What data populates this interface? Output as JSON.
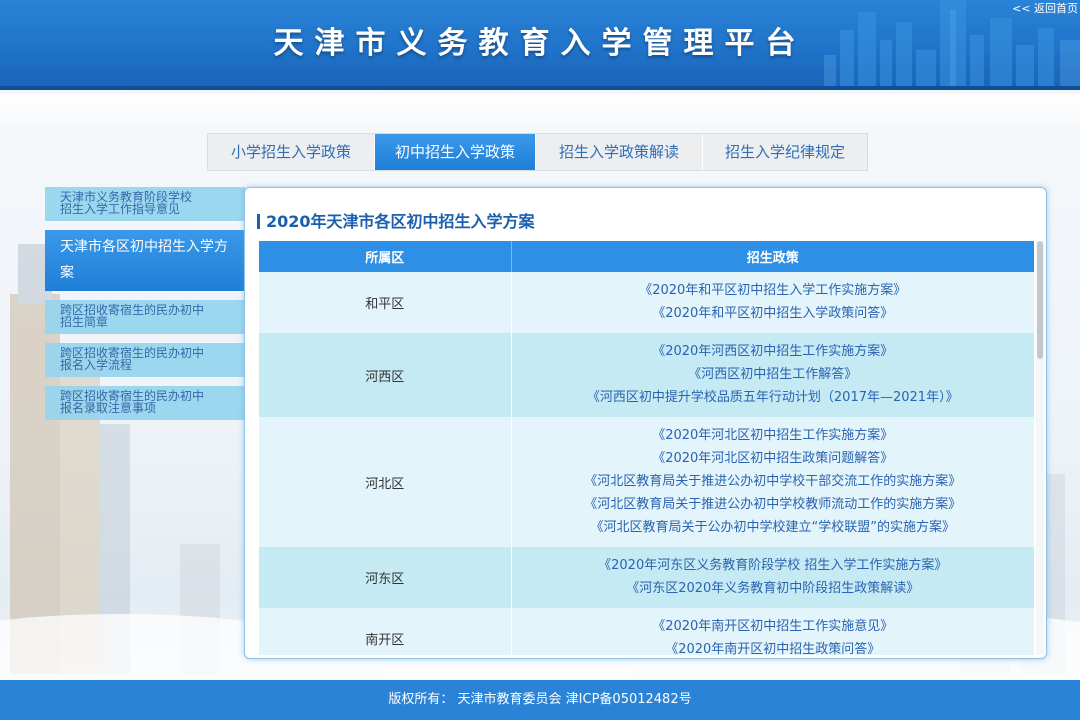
{
  "header": {
    "title": "天津市义务教育入学管理平台",
    "back_link": "<< 返回首页"
  },
  "tabs": [
    {
      "label": "小学招生入学政策",
      "active": false
    },
    {
      "label": "初中招生入学政策",
      "active": true
    },
    {
      "label": "招生入学政策解读",
      "active": false
    },
    {
      "label": "招生入学纪律规定",
      "active": false
    }
  ],
  "sidebar": {
    "items": [
      {
        "line1": "天津市义务教育阶段学校",
        "line2": "招生入学工作指导意见"
      },
      {
        "label": "天津市各区初中招生入学方案",
        "active": true
      },
      {
        "line1": "跨区招收寄宿生的民办初中",
        "line2": "招生简章"
      },
      {
        "line1": "跨区招收寄宿生的民办初中",
        "line2": "报名入学流程"
      },
      {
        "line1": "跨区招收寄宿生的民办初中",
        "line2": "报名录取注意事项"
      }
    ]
  },
  "main": {
    "title": "2020年天津市各区初中招生入学方案",
    "table": {
      "headers": [
        "所属区",
        "招生政策"
      ],
      "rows": [
        {
          "district": "和平区",
          "policies": [
            "《2020年和平区初中招生入学工作实施方案》",
            "《2020年和平区初中招生入学政策问答》"
          ]
        },
        {
          "district": "河西区",
          "policies": [
            "《2020年河西区初中招生工作实施方案》",
            "《河西区初中招生工作解答》",
            "《河西区初中提升学校品质五年行动计划（2017年—2021年）》"
          ]
        },
        {
          "district": "河北区",
          "policies": [
            "《2020年河北区初中招生工作实施方案》",
            "《2020年河北区初中招生政策问题解答》",
            "《河北区教育局关于推进公办初中学校干部交流工作的实施方案》",
            "《河北区教育局关于推进公办初中学校教师流动工作的实施方案》",
            "《河北区教育局关于公办初中学校建立“学校联盟”的实施方案》"
          ]
        },
        {
          "district": "河东区",
          "policies": [
            "《2020年河东区义务教育阶段学校 招生入学工作实施方案》",
            "《河东区2020年义务教育初中阶段招生政策解读》"
          ]
        },
        {
          "district": "南开区",
          "policies": [
            "《2020年南开区初中招生工作实施意见》",
            "《2020年南开区初中招生政策问答》"
          ]
        }
      ]
    }
  },
  "footer": {
    "copyright": "版权所有：  天津市教育委员会    津ICP备05012482号"
  },
  "colors": {
    "header_blue": "#1f72c9",
    "active_blue": "#2e8fe6",
    "row_light": "#e3f4fb",
    "row_dark": "#c6eaf3",
    "link_blue": "#2a63b1"
  }
}
